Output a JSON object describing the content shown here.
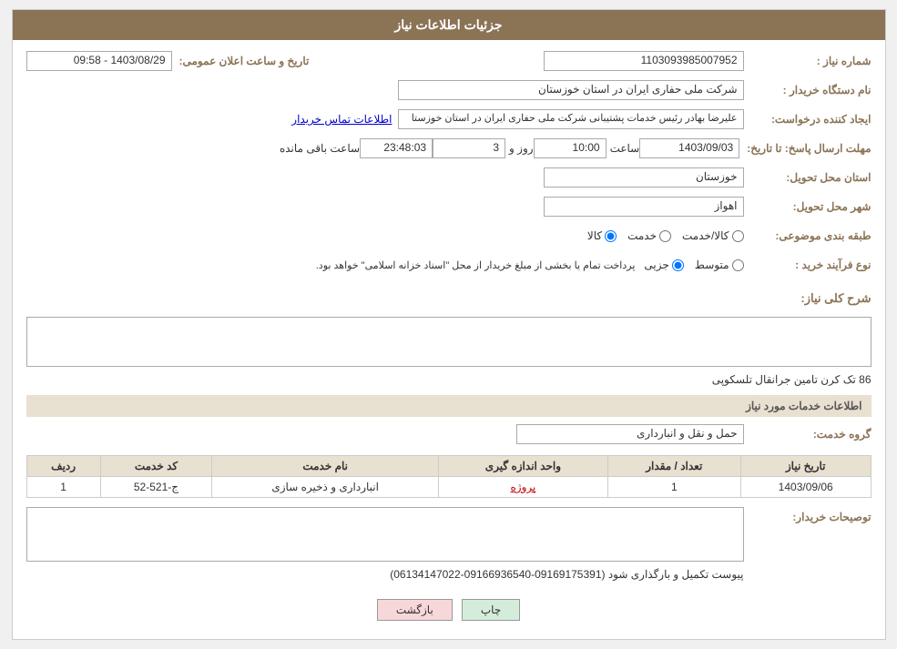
{
  "page": {
    "title": "جزئیات اطلاعات نیاز",
    "header": {
      "background": "#8B7355"
    }
  },
  "fields": {
    "need_number_label": "شماره نیاز :",
    "need_number_value": "1103093985007952",
    "buyer_org_label": "نام دستگاه خریدار :",
    "buyer_org_value": "شرکت ملی حفاری ایران در استان خوزستان",
    "creator_label": "ایجاد کننده درخواست:",
    "creator_value": "علیرضا بهادر رئیس خدمات پشتیبانی شرکت ملی حفاری ایران در استان خوزستا",
    "contact_link": "اطلاعات تماس خریدار",
    "response_deadline_label": "مهلت ارسال پاسخ: تا تاریخ:",
    "response_date": "1403/09/03",
    "response_time_label": "ساعت",
    "response_time": "10:00",
    "response_day_label": "روز و",
    "response_days": "3",
    "remaining_label": "ساعت باقی مانده",
    "remaining_time": "23:48:03",
    "announce_label": "تاریخ و ساعت اعلان عمومی:",
    "announce_value": "1403/08/29 - 09:58",
    "province_label": "استان محل تحویل:",
    "province_value": "خوزستان",
    "city_label": "شهر محل تحویل:",
    "city_value": "اهواز",
    "category_label": "طبقه بندی موضوعی:",
    "category_options": [
      "کالا",
      "خدمت",
      "کالا/خدمت"
    ],
    "category_selected": "کالا",
    "purchase_type_label": "نوع فرآیند خرید :",
    "purchase_options": [
      "جزیی",
      "متوسط"
    ],
    "purchase_note": "پرداخت تمام یا بخشی از مبلغ خریدار از محل \"اسناد خزانه اسلامی\" خواهد بود.",
    "description_section_label": "شرح کلی نیاز:",
    "description_text": "86 تک کرن  تامین جرانقال تلسکوپی",
    "services_section": "اطلاعات خدمات مورد نیاز",
    "service_group_label": "گروه خدمت:",
    "service_group_value": "حمل و نقل و انبارداری",
    "table": {
      "columns": [
        "ردیف",
        "کد خدمت",
        "نام خدمت",
        "واحد اندازه گیری",
        "تعداد / مقدار",
        "تاریخ نیاز"
      ],
      "rows": [
        {
          "row": "1",
          "code": "ج-521-52",
          "name": "انبارداری و ذخیره سازی",
          "unit": "پروژه",
          "quantity": "1",
          "date": "1403/09/06"
        }
      ]
    },
    "buyer_note_label": "توصیحات خریدار:",
    "buyer_note_text": "پیوست تکمیل و بارگذاری شود (09169175391-09166936540-06134147022)",
    "print_button": "چاپ",
    "back_button": "بازگشت"
  }
}
